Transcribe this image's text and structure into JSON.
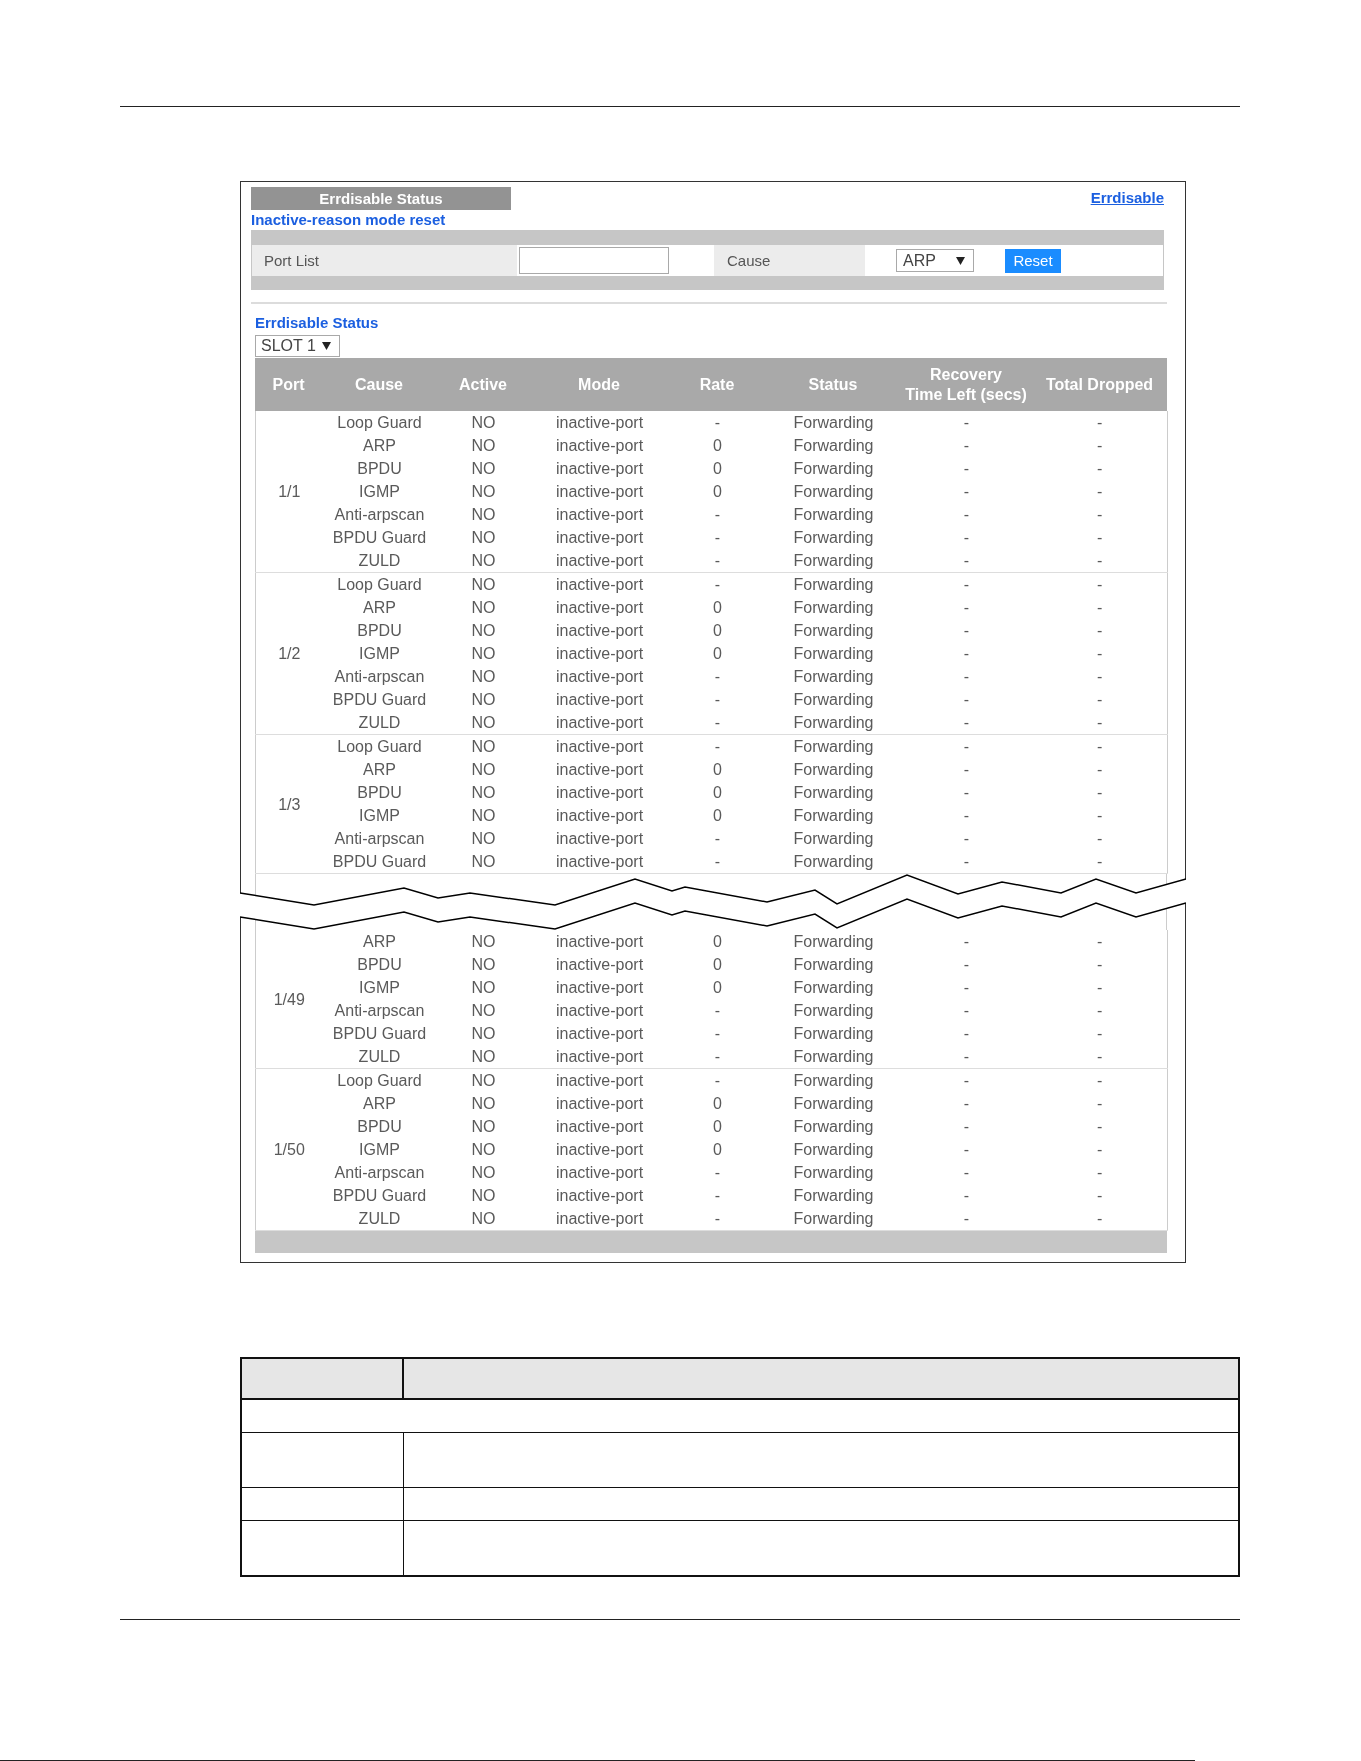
{
  "top_panel": {
    "title": "Errdisable Status",
    "link": "Errdisable"
  },
  "reset_form": {
    "title": "Inactive-reason mode reset",
    "port_list": {
      "label": "Port List"
    },
    "cause": {
      "label": "Cause",
      "value": "ARP"
    },
    "button": "Reset"
  },
  "status": {
    "title": "Errdisable Status",
    "slot": "SLOT 1",
    "columns": [
      "Port",
      "Cause",
      "Active",
      "Mode",
      "Rate",
      "Status",
      "Recovery\nTime Left (secs)",
      "Total Dropped"
    ],
    "groups": [
      {
        "kind": "port",
        "port": "1/1",
        "rows": [
          [
            "Loop Guard",
            "NO",
            "inactive-port",
            "-",
            "Forwarding",
            "-",
            "-"
          ],
          [
            "ARP",
            "NO",
            "inactive-port",
            "0",
            "Forwarding",
            "-",
            "-"
          ],
          [
            "BPDU",
            "NO",
            "inactive-port",
            "0",
            "Forwarding",
            "-",
            "-"
          ],
          [
            "IGMP",
            "NO",
            "inactive-port",
            "0",
            "Forwarding",
            "-",
            "-"
          ],
          [
            "Anti-arpscan",
            "NO",
            "inactive-port",
            "-",
            "Forwarding",
            "-",
            "-"
          ],
          [
            "BPDU Guard",
            "NO",
            "inactive-port",
            "-",
            "Forwarding",
            "-",
            "-"
          ],
          [
            "ZULD",
            "NO",
            "inactive-port",
            "-",
            "Forwarding",
            "-",
            "-"
          ]
        ]
      },
      {
        "kind": "port",
        "port": "1/2",
        "rows": [
          [
            "Loop Guard",
            "NO",
            "inactive-port",
            "-",
            "Forwarding",
            "-",
            "-"
          ],
          [
            "ARP",
            "NO",
            "inactive-port",
            "0",
            "Forwarding",
            "-",
            "-"
          ],
          [
            "BPDU",
            "NO",
            "inactive-port",
            "0",
            "Forwarding",
            "-",
            "-"
          ],
          [
            "IGMP",
            "NO",
            "inactive-port",
            "0",
            "Forwarding",
            "-",
            "-"
          ],
          [
            "Anti-arpscan",
            "NO",
            "inactive-port",
            "-",
            "Forwarding",
            "-",
            "-"
          ],
          [
            "BPDU Guard",
            "NO",
            "inactive-port",
            "-",
            "Forwarding",
            "-",
            "-"
          ],
          [
            "ZULD",
            "NO",
            "inactive-port",
            "-",
            "Forwarding",
            "-",
            "-"
          ]
        ]
      },
      {
        "kind": "port",
        "port": "1/3",
        "rows": [
          [
            "Loop Guard",
            "NO",
            "inactive-port",
            "-",
            "Forwarding",
            "-",
            "-"
          ],
          [
            "ARP",
            "NO",
            "inactive-port",
            "0",
            "Forwarding",
            "-",
            "-"
          ],
          [
            "BPDU",
            "NO",
            "inactive-port",
            "0",
            "Forwarding",
            "-",
            "-"
          ],
          [
            "IGMP",
            "NO",
            "inactive-port",
            "0",
            "Forwarding",
            "-",
            "-"
          ],
          [
            "Anti-arpscan",
            "NO",
            "inactive-port",
            "-",
            "Forwarding",
            "-",
            "-"
          ],
          [
            "BPDU Guard",
            "NO",
            "inactive-port",
            "-",
            "Forwarding",
            "-",
            "-"
          ]
        ]
      },
      {
        "kind": "break"
      },
      {
        "kind": "port",
        "port": "1/49",
        "rows": [
          [
            "ARP",
            "NO",
            "inactive-port",
            "0",
            "Forwarding",
            "-",
            "-"
          ],
          [
            "BPDU",
            "NO",
            "inactive-port",
            "0",
            "Forwarding",
            "-",
            "-"
          ],
          [
            "IGMP",
            "NO",
            "inactive-port",
            "0",
            "Forwarding",
            "-",
            "-"
          ],
          [
            "Anti-arpscan",
            "NO",
            "inactive-port",
            "-",
            "Forwarding",
            "-",
            "-"
          ],
          [
            "BPDU Guard",
            "NO",
            "inactive-port",
            "-",
            "Forwarding",
            "-",
            "-"
          ],
          [
            "ZULD",
            "NO",
            "inactive-port",
            "-",
            "Forwarding",
            "-",
            "-"
          ]
        ]
      },
      {
        "kind": "port",
        "port": "1/50",
        "rows": [
          [
            "Loop Guard",
            "NO",
            "inactive-port",
            "-",
            "Forwarding",
            "-",
            "-"
          ],
          [
            "ARP",
            "NO",
            "inactive-port",
            "0",
            "Forwarding",
            "-",
            "-"
          ],
          [
            "BPDU",
            "NO",
            "inactive-port",
            "0",
            "Forwarding",
            "-",
            "-"
          ],
          [
            "IGMP",
            "NO",
            "inactive-port",
            "0",
            "Forwarding",
            "-",
            "-"
          ],
          [
            "Anti-arpscan",
            "NO",
            "inactive-port",
            "-",
            "Forwarding",
            "-",
            "-"
          ],
          [
            "BPDU Guard",
            "NO",
            "inactive-port",
            "-",
            "Forwarding",
            "-",
            "-"
          ],
          [
            "ZULD",
            "NO",
            "inactive-port",
            "-",
            "Forwarding",
            "-",
            "-"
          ]
        ]
      }
    ]
  },
  "description_table": {
    "rows": [
      {
        "kind": "header"
      },
      {
        "kind": "section"
      },
      {
        "kind": "tall"
      },
      {
        "kind": "short"
      },
      {
        "kind": "tall"
      }
    ]
  }
}
